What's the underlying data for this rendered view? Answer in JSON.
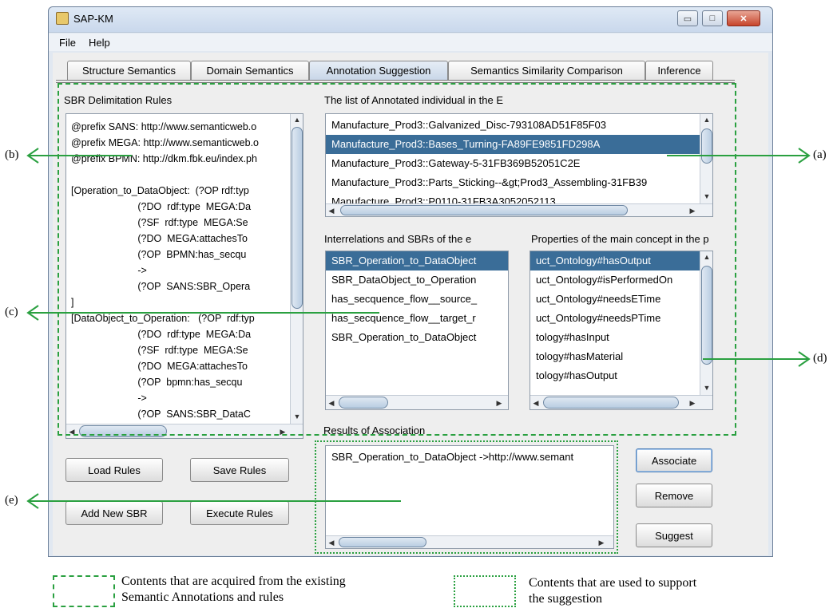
{
  "window": {
    "title": "SAP-KM",
    "icon": "java-app-icon"
  },
  "window_controls": {
    "minimize": "▭",
    "maximize": "□",
    "close": "✕"
  },
  "menu": [
    "File",
    "Help"
  ],
  "tabs": [
    {
      "label": "Structure Semantics"
    },
    {
      "label": "Domain Semantics"
    },
    {
      "label": "Annotation Suggestion",
      "active": true
    },
    {
      "label": "Semantics Similarity Comparison"
    },
    {
      "label": "Inference"
    }
  ],
  "rules_panel": {
    "title": "SBR Delimitation Rules",
    "lines": [
      "@prefix SANS: http://www.semanticweb.o",
      "@prefix MEGA: http://www.semanticweb.o",
      "@prefix BPMN: http://dkm.fbk.eu/index.ph",
      "",
      "[Operation_to_DataObject:  (?OP rdf:typ",
      "                        (?DO  rdf:type  MEGA:Da",
      "                        (?SF  rdf:type  MEGA:Se",
      "                        (?DO  MEGA:attachesTo",
      "                        (?OP  BPMN:has_secqu",
      "                        ->",
      "                        (?OP  SANS:SBR_Opera",
      "]",
      "[DataObject_to_Operation:   (?OP  rdf:typ",
      "                        (?DO  rdf:type  MEGA:Da",
      "                        (?SF  rdf:type  MEGA:Se",
      "                        (?DO  MEGA:attachesTo",
      "                        (?OP  bpmn:has_secqu",
      "                        ->",
      "                        (?OP  SANS:SBR_DataC",
      "]"
    ]
  },
  "individuals_panel": {
    "title": "The list of Annotated individual in the E",
    "items": [
      "Manufacture_Prod3::Galvanized_Disc-793108AD51F85F03",
      "Manufacture_Prod3::Bases_Turning-FA89FE9851FD298A",
      "Manufacture_Prod3::Gateway-5-31FB369B52051C2E",
      "Manufacture_Prod3::Parts_Sticking--&gt;Prod3_Assembling-31FB39",
      "Manufacture_Prod3::P0110-31FB3A3052052113"
    ],
    "selected_index": 1
  },
  "interrelations_panel": {
    "title": "Interrelations and SBRs of the e",
    "items": [
      "SBR_Operation_to_DataObject",
      "SBR_DataObject_to_Operation",
      "has_secquence_flow__source_",
      "has_secquence_flow__target_r",
      "SBR_Operation_to_DataObject"
    ],
    "selected_index": 0
  },
  "properties_panel": {
    "title": "Properties of the main concept in the p",
    "items": [
      "uct_Ontology#hasOutput",
      "uct_Ontology#isPerformedOn",
      "uct_Ontology#needsETime",
      "uct_Ontology#needsPTime",
      "tology#hasInput",
      "tology#hasMaterial",
      "tology#hasOutput"
    ],
    "selected_index": 0
  },
  "results_panel": {
    "title": "Results of Association",
    "items": [
      "SBR_Operation_to_DataObject ->http://www.semant"
    ]
  },
  "buttons": {
    "load_rules": "Load Rules",
    "save_rules": "Save Rules",
    "add_new_sbr": "Add New SBR",
    "execute_rules": "Execute Rules",
    "associate": "Associate",
    "remove": "Remove",
    "suggest": "Suggest"
  },
  "annotations": {
    "a": "(a)",
    "b": "(b)",
    "c": "(c)",
    "d": "(d)",
    "e": "(e)"
  },
  "legend": {
    "dashed": "Contents that are acquired from the existing Semantic Annotations and rules",
    "dashed_line1": "Contents that are acquired from the existing",
    "dashed_line2": "Semantic Annotations and rules",
    "dotted_line1": "Contents that are used to support",
    "dotted_line2": "the suggestion"
  },
  "colors": {
    "annotation_green": "#2aa040",
    "selection_blue": "#3a6d98"
  }
}
